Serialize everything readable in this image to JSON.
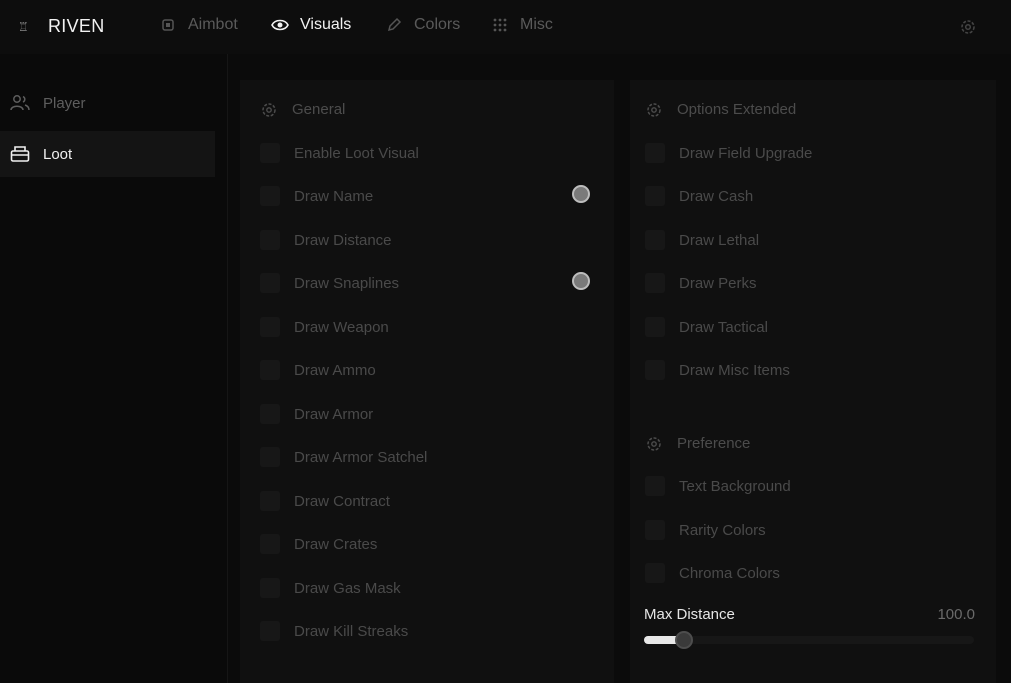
{
  "app": {
    "name": "RIVEN"
  },
  "tabs": [
    {
      "label": "Aimbot",
      "icon": "cpu-icon",
      "active": false
    },
    {
      "label": "Visuals",
      "icon": "eye-icon",
      "active": true
    },
    {
      "label": "Colors",
      "icon": "pen-icon",
      "active": false
    },
    {
      "label": "Misc",
      "icon": "dots-grid-icon",
      "active": false
    }
  ],
  "sidebar": {
    "items": [
      {
        "label": "Player",
        "icon": "users-icon",
        "active": false
      },
      {
        "label": "Loot",
        "icon": "package-icon",
        "active": true
      }
    ]
  },
  "general": {
    "title": "General",
    "items": [
      {
        "label": "Enable Loot Visual"
      },
      {
        "label": "Draw Name",
        "radio": true
      },
      {
        "label": "Draw Distance"
      },
      {
        "label": "Draw Snaplines",
        "radio": true
      },
      {
        "label": "Draw Weapon"
      },
      {
        "label": "Draw Ammo"
      },
      {
        "label": "Draw Armor"
      },
      {
        "label": "Draw Armor Satchel"
      },
      {
        "label": "Draw Contract"
      },
      {
        "label": "Draw Crates"
      },
      {
        "label": "Draw Gas Mask"
      },
      {
        "label": "Draw Kill Streaks"
      }
    ]
  },
  "options_extended": {
    "title": "Options Extended",
    "items": [
      {
        "label": "Draw Field Upgrade"
      },
      {
        "label": "Draw Cash"
      },
      {
        "label": "Draw Lethal"
      },
      {
        "label": "Draw Perks"
      },
      {
        "label": "Draw Tactical"
      },
      {
        "label": "Draw Misc Items"
      }
    ]
  },
  "preference": {
    "title": "Preference",
    "items": [
      {
        "label": "Text Background"
      },
      {
        "label": "Rarity Colors"
      },
      {
        "label": "Chroma Colors"
      }
    ]
  },
  "max_distance": {
    "label": "Max Distance",
    "value": "100.0",
    "fraction": 0.12
  },
  "colors": {
    "accent": "#e8e8e8",
    "bg": "#0b0b0b",
    "panel": "#101010"
  }
}
